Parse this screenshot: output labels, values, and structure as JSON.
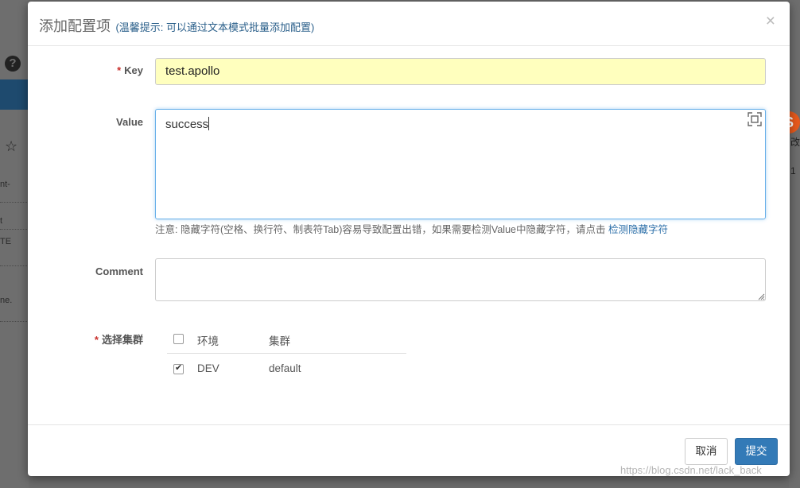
{
  "modal": {
    "title": "添加配置项",
    "hint": "(温馨提示: 可以通过文本模式批量添加配置)",
    "close_symbol": "×"
  },
  "form": {
    "key_required_mark": "*",
    "key_label": "Key",
    "key_value": "test.apollo",
    "value_label": "Value",
    "value_value": "success",
    "value_hint": "注意: 隐藏字符(空格、换行符、制表符Tab)容易导致配置出错，如果需要检测Value中隐藏字符，请点击",
    "value_hint_link": "检测隐藏字符",
    "comment_label": "Comment",
    "comment_value": "",
    "cluster_required_mark": "*",
    "cluster_label": "选择集群"
  },
  "cluster_table": {
    "headers": [
      "环境",
      "集群"
    ],
    "select_all_checked": false,
    "rows": [
      {
        "env": "DEV",
        "cluster": "default",
        "checked": true
      }
    ]
  },
  "footer": {
    "cancel_label": "取消",
    "submit_label": "提交"
  },
  "background": {
    "help_symbol": "?",
    "left_texts": [
      "nt-",
      "t",
      "TE",
      "ne."
    ],
    "right_texts": [
      "改",
      "1"
    ]
  },
  "watermark": "https://blog.csdn.net/lack_back",
  "colors": {
    "primary": "#337ab7",
    "key_field_bg": "#ffffbe",
    "required": "#c9302c",
    "link": "#2a6ea8"
  }
}
